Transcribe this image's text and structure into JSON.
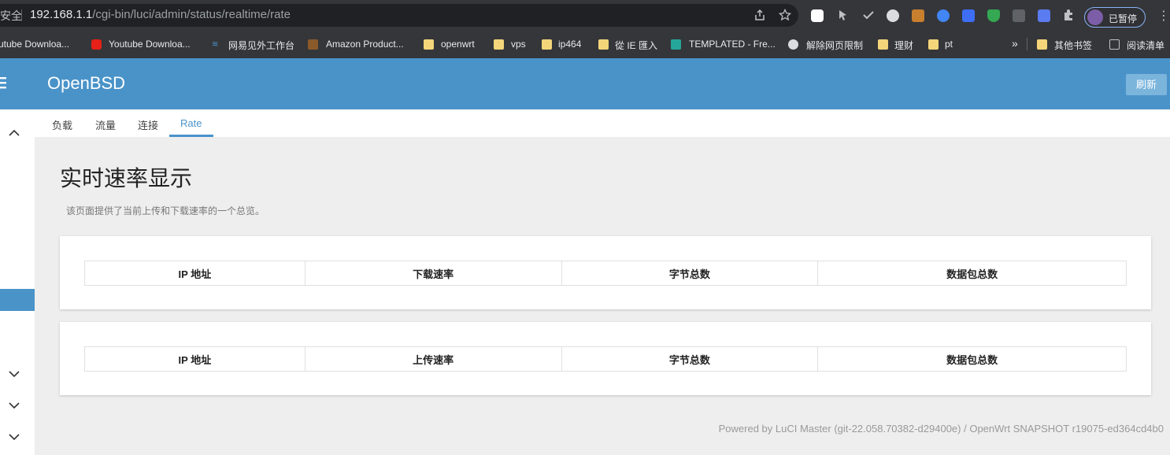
{
  "browser": {
    "security_label": "安全",
    "url_host": "192.168.1.1",
    "url_path": "/cgi-bin/luci/admin/status/realtime/rate",
    "profile_label": "已暂停",
    "bookmarks": [
      "utube Downloa...",
      "Youtube Downloa...",
      "网易见外工作台",
      "Amazon Product...",
      "openwrt",
      "vps",
      "ip464",
      "從 IE 匯入",
      "TEMPLATED - Fre...",
      "解除网页限制",
      "理财",
      "pt"
    ],
    "more_bookmarks": "»",
    "other_bookmarks": "其他书签",
    "reading_list": "阅读清单"
  },
  "header": {
    "brand": "OpenBSD",
    "refresh_label": "刷新"
  },
  "tabs": [
    {
      "label": "负载"
    },
    {
      "label": "流量"
    },
    {
      "label": "连接"
    },
    {
      "label": "Rate"
    }
  ],
  "main": {
    "title": "实时速率显示",
    "description": "该页面提供了当前上传和下载速率的一个总览。",
    "download_table": {
      "headers": [
        "IP 地址",
        "下载速率",
        "字节总数",
        "数据包总数"
      ]
    },
    "upload_table": {
      "headers": [
        "IP 地址",
        "上传速率",
        "字节总数",
        "数据包总数"
      ]
    }
  },
  "footer": "Powered by LuCI Master (git-22.058.70382-d29400e) / OpenWrt SNAPSHOT r19075-ed364cd4b0"
}
